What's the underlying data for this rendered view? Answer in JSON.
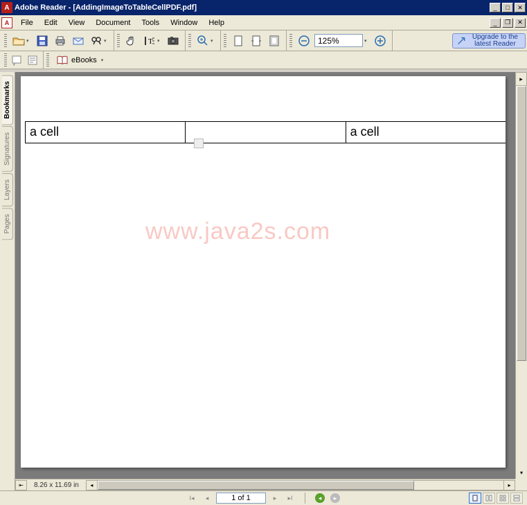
{
  "title": "Adobe Reader - [AddingImageToTableCellPDF.pdf]",
  "menus": [
    "File",
    "Edit",
    "View",
    "Document",
    "Tools",
    "Window",
    "Help"
  ],
  "zoom": "125%",
  "upgrade": {
    "line1": "Upgrade to the",
    "line2": "latest Reader"
  },
  "ebooks_label": "eBooks",
  "side_tabs": [
    "Bookmarks",
    "Signatures",
    "Layers",
    "Pages"
  ],
  "table_cells": [
    "a cell",
    "",
    "a cell"
  ],
  "watermark": "www.java2s.com",
  "page_dims": "8.26 x 11.69 in",
  "page_indicator": "1 of 1"
}
